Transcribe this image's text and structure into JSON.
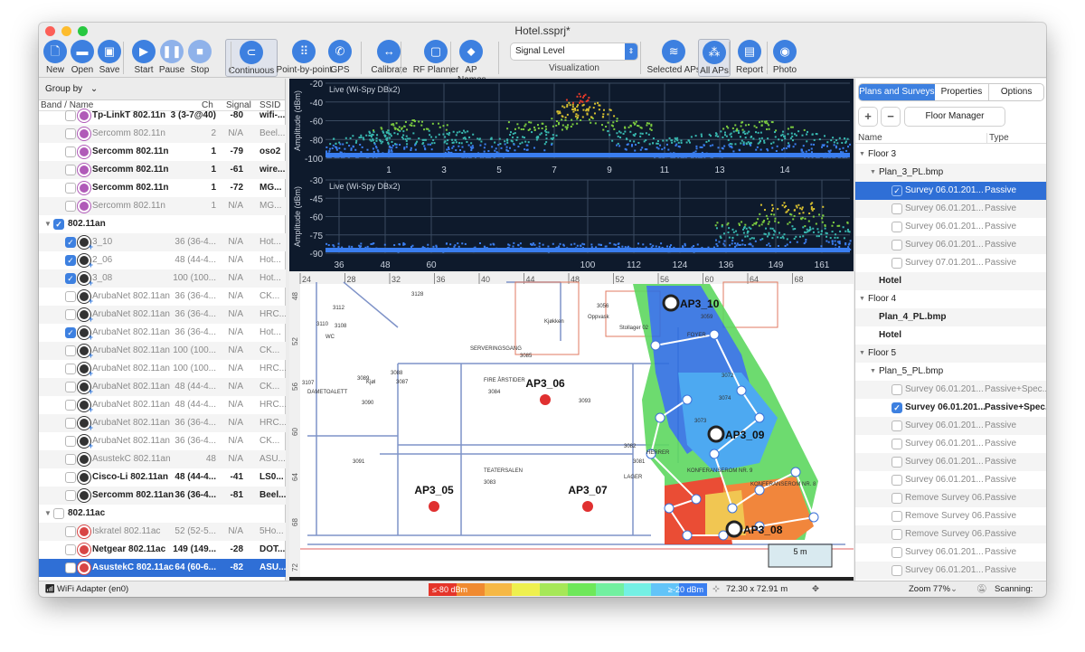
{
  "window": {
    "title": "Hotel.ssprj*"
  },
  "toolbar": {
    "buttons": [
      {
        "label": "New",
        "icon": "document-icon"
      },
      {
        "label": "Open",
        "icon": "folder-icon"
      },
      {
        "label": "Save",
        "icon": "floppy-icon"
      },
      {
        "label": "Start",
        "icon": "play-icon"
      },
      {
        "label": "Pause",
        "icon": "pause-icon"
      },
      {
        "label": "Stop",
        "icon": "stop-icon"
      },
      {
        "label": "Continuous",
        "icon": "continuous-icon",
        "active": true
      },
      {
        "label": "Point-by-point",
        "icon": "grid-dots-icon"
      },
      {
        "label": "GPS",
        "icon": "satellite-icon"
      },
      {
        "label": "Calibrate",
        "icon": "arrows-horizontal-icon"
      },
      {
        "label": "RF Planner",
        "icon": "square-frame-icon"
      },
      {
        "label": "AP Names",
        "icon": "tag-icon"
      },
      {
        "label": "Selected APs",
        "icon": "wifi-selected-icon"
      },
      {
        "label": "All APs",
        "icon": "wifi-all-icon",
        "active": true
      },
      {
        "label": "Report",
        "icon": "report-icon"
      },
      {
        "label": "Photo",
        "icon": "camera-icon"
      }
    ],
    "visualization": {
      "value": "Signal Level",
      "label": "Visualization"
    }
  },
  "left_panel": {
    "group_by": "Group by",
    "columns": [
      "Band / Name",
      "Ch",
      "Signal",
      "SSID"
    ],
    "rows": [
      {
        "name": "Tp-LinkT 802.11n",
        "ch": "3 (3-7@40)",
        "signal": "-80",
        "ssid": "wifi-...",
        "style": "bold",
        "checked": false,
        "icon": "purple"
      },
      {
        "name": "Sercomm 802.11n",
        "ch": "2",
        "signal": "N/A",
        "ssid": "Beel...",
        "style": "gray",
        "checked": false,
        "icon": "purple"
      },
      {
        "name": "Sercomm 802.11n",
        "ch": "1",
        "signal": "-79",
        "ssid": "oso2",
        "style": "bold",
        "checked": false,
        "icon": "purple"
      },
      {
        "name": "Sercomm 802.11n",
        "ch": "1",
        "signal": "-61",
        "ssid": "wire...",
        "style": "bold",
        "checked": false,
        "icon": "purple"
      },
      {
        "name": "Sercomm 802.11n",
        "ch": "1",
        "signal": "-72",
        "ssid": "MG...",
        "style": "bold",
        "checked": false,
        "icon": "purple"
      },
      {
        "name": "Sercomm 802.11n",
        "ch": "1",
        "signal": "N/A",
        "ssid": "MG...",
        "style": "gray",
        "checked": false,
        "icon": "purple"
      },
      {
        "group": true,
        "name": "802.11an",
        "checked": true
      },
      {
        "name": "3_10",
        "ch": "36 (36-4...",
        "signal": "N/A",
        "ssid": "Hot...",
        "style": "gray",
        "checked": true,
        "icon": "dark-plus"
      },
      {
        "name": "2_06",
        "ch": "48 (44-4...",
        "signal": "N/A",
        "ssid": "Hot...",
        "style": "gray",
        "checked": true,
        "icon": "dark-plus"
      },
      {
        "name": "3_08",
        "ch": "100 (100...",
        "signal": "N/A",
        "ssid": "Hot...",
        "style": "gray",
        "checked": true,
        "icon": "dark-plus"
      },
      {
        "name": "ArubaNet 802.11an",
        "ch": "36 (36-4...",
        "signal": "N/A",
        "ssid": "CK...",
        "style": "gray",
        "checked": false,
        "icon": "dark-plus"
      },
      {
        "name": "ArubaNet 802.11an",
        "ch": "36 (36-4...",
        "signal": "N/A",
        "ssid": "HRC...",
        "style": "gray",
        "checked": false,
        "icon": "dark-plus"
      },
      {
        "name": "ArubaNet 802.11an",
        "ch": "36 (36-4...",
        "signal": "N/A",
        "ssid": "Hot...",
        "style": "gray",
        "checked": true,
        "icon": "dark-plus"
      },
      {
        "name": "ArubaNet 802.11an",
        "ch": "100 (100...",
        "signal": "N/A",
        "ssid": "CK...",
        "style": "gray",
        "checked": false,
        "icon": "dark-plus"
      },
      {
        "name": "ArubaNet 802.11an",
        "ch": "100 (100...",
        "signal": "N/A",
        "ssid": "HRC...",
        "style": "gray",
        "checked": false,
        "icon": "dark-plus"
      },
      {
        "name": "ArubaNet 802.11an",
        "ch": "48 (44-4...",
        "signal": "N/A",
        "ssid": "CK...",
        "style": "gray",
        "checked": false,
        "icon": "dark-plus"
      },
      {
        "name": "ArubaNet 802.11an",
        "ch": "48 (44-4...",
        "signal": "N/A",
        "ssid": "HRC...",
        "style": "gray",
        "checked": false,
        "icon": "dark-plus"
      },
      {
        "name": "ArubaNet 802.11an",
        "ch": "36 (36-4...",
        "signal": "N/A",
        "ssid": "HRC...",
        "style": "gray",
        "checked": false,
        "icon": "dark-plus"
      },
      {
        "name": "ArubaNet 802.11an",
        "ch": "36 (36-4...",
        "signal": "N/A",
        "ssid": "CK...",
        "style": "gray",
        "checked": false,
        "icon": "dark-plus"
      },
      {
        "name": "AsustekC 802.11an",
        "ch": "48",
        "signal": "N/A",
        "ssid": "ASU...",
        "style": "gray",
        "checked": false,
        "icon": "dark"
      },
      {
        "name": "Cisco-Li 802.11an",
        "ch": "48 (44-4...",
        "signal": "-41",
        "ssid": "LS0...",
        "style": "bold",
        "checked": false,
        "icon": "dark"
      },
      {
        "name": "Sercomm 802.11an",
        "ch": "36 (36-4...",
        "signal": "-81",
        "ssid": "Beel...",
        "style": "bold",
        "checked": false,
        "icon": "dark"
      },
      {
        "group": true,
        "name": "802.11ac",
        "checked": false
      },
      {
        "name": "Iskratel 802.11ac",
        "ch": "52 (52-5...",
        "signal": "N/A",
        "ssid": "5Ho...",
        "style": "gray",
        "checked": false,
        "icon": "red"
      },
      {
        "name": "Netgear 802.11ac",
        "ch": "149 (149...",
        "signal": "-28",
        "ssid": "DOT...",
        "style": "bold",
        "checked": false,
        "icon": "red"
      },
      {
        "name": "AsustekC 802.11ac",
        "ch": "64 (60-6...",
        "signal": "-82",
        "ssid": "ASU...",
        "style": "selected",
        "checked": false,
        "icon": "red"
      }
    ],
    "adapter": "WiFi Adapter (en0)"
  },
  "spectrum": {
    "top": {
      "title": "Live (Wi-Spy DBx2)",
      "ylabel": "Amplitude (dBm)",
      "yticks": [
        "-20",
        "-40",
        "-60",
        "-80",
        "-100"
      ],
      "xticks": [
        "1",
        "3",
        "5",
        "7",
        "9",
        "11",
        "13",
        "14"
      ]
    },
    "bottom": {
      "title": "Live (Wi-Spy DBx2)",
      "ylabel": "Amplitude (dBm)",
      "yticks": [
        "-30",
        "-45",
        "-60",
        "-75",
        "-90"
      ],
      "xticks": [
        "36",
        "48",
        "60",
        "100",
        "112",
        "124",
        "136",
        "149",
        "161"
      ]
    }
  },
  "floorplan": {
    "ruler_x": [
      "24",
      "28",
      "32",
      "36",
      "40",
      "44",
      "48",
      "52",
      "56",
      "60",
      "64",
      "68"
    ],
    "ruler_y": [
      "48",
      "52",
      "56",
      "60",
      "64",
      "68",
      "72"
    ],
    "aps": [
      {
        "label": "AP3_06"
      },
      {
        "label": "AP3_05"
      },
      {
        "label": "AP3_07"
      },
      {
        "label": "AP3_10"
      },
      {
        "label": "AP3_09"
      },
      {
        "label": "AP3_08"
      }
    ],
    "rooms": [
      "3128",
      "3112",
      "3110",
      "3108",
      "WC",
      "3107",
      "DAMETOALETT",
      "3089",
      "3088",
      "Kjøl",
      "3087",
      "SERVERINGSGANG",
      "3085",
      "Kjøkken",
      "3056",
      "Oppvask",
      "Stollager 02",
      "FIRE ÅRSTIDER",
      "3084",
      "3090",
      "3091",
      "TEATERSALEN",
      "3083",
      "3093",
      "3081",
      "3082",
      "HERRER",
      "LAGER",
      "FOYER",
      "3059",
      "3072",
      "3074",
      "3073",
      "KONFERANSEROM NR. 9",
      "KONFERANSEROM NR. 8"
    ],
    "scale": "5 m"
  },
  "right_panel": {
    "tabs": [
      "Plans and Surveys",
      "Properties",
      "Options"
    ],
    "add": "+",
    "remove": "−",
    "floor_manager": "Floor Manager",
    "columns": [
      "Name",
      "Type"
    ],
    "rows": [
      {
        "level": 0,
        "name": "Floor 3",
        "tri": true
      },
      {
        "level": 1,
        "name": "Plan_3_PL.bmp",
        "tri": true
      },
      {
        "level": 2,
        "name": "Survey 06.01.201...",
        "type": "Passive",
        "checked": true,
        "selected": true
      },
      {
        "level": 2,
        "name": "Survey 06.01.201...",
        "type": "Passive",
        "checked": false
      },
      {
        "level": 2,
        "name": "Survey 06.01.201...",
        "type": "Passive",
        "checked": false
      },
      {
        "level": 2,
        "name": "Survey 06.01.201...",
        "type": "Passive",
        "checked": false
      },
      {
        "level": 2,
        "name": "Survey 07.01.201...",
        "type": "Passive",
        "checked": false
      },
      {
        "level": 1,
        "name": "Hotel"
      },
      {
        "level": 0,
        "name": "Floor 4",
        "tri": true
      },
      {
        "level": 1,
        "name": "Plan_4_PL.bmp"
      },
      {
        "level": 1,
        "name": "Hotel"
      },
      {
        "level": 0,
        "name": "Floor 5",
        "tri": true
      },
      {
        "level": 1,
        "name": "Plan_5_PL.bmp",
        "tri": true
      },
      {
        "level": 2,
        "name": "Survey 06.01.201...",
        "type": "Passive+Spec...",
        "checked": false
      },
      {
        "level": 2,
        "name": "Survey 06.01.201...",
        "type": "Passive+Spec...",
        "checked": true,
        "bold": true
      },
      {
        "level": 2,
        "name": "Survey 06.01.201...",
        "type": "Passive",
        "checked": false
      },
      {
        "level": 2,
        "name": "Survey 06.01.201...",
        "type": "Passive",
        "checked": false
      },
      {
        "level": 2,
        "name": "Survey 06.01.201...",
        "type": "Passive",
        "checked": false
      },
      {
        "level": 2,
        "name": "Survey 06.01.201...",
        "type": "Passive",
        "checked": false
      },
      {
        "level": 2,
        "name": "Remove Survey 06...",
        "type": "Passive",
        "checked": false
      },
      {
        "level": 2,
        "name": "Remove Survey 06...",
        "type": "Passive",
        "checked": false
      },
      {
        "level": 2,
        "name": "Remove Survey 06...",
        "type": "Passive",
        "checked": false
      },
      {
        "level": 2,
        "name": "Survey 06.01.201...",
        "type": "Passive",
        "checked": false
      },
      {
        "level": 2,
        "name": "Survey 06.01.201...",
        "type": "Passive",
        "checked": false
      }
    ]
  },
  "status": {
    "legend_min": "≤-80 dBm",
    "legend_max": "≥-20 dBm",
    "legend_colors": [
      "#e5352a",
      "#f08a30",
      "#f6b845",
      "#eef04e",
      "#a6e858",
      "#6ee85a",
      "#72f0a0",
      "#74f0e4",
      "#62c4f8",
      "#3a7ef0"
    ],
    "dimensions": "72.30 x 72.91 m",
    "zoom": "Zoom 77%",
    "scanning": "Scanning: On"
  }
}
